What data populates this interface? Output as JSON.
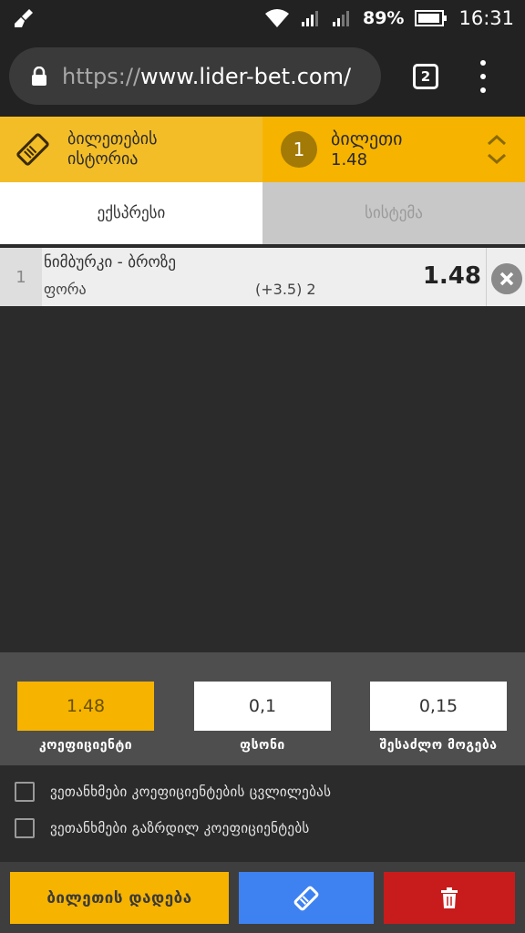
{
  "status_bar": {
    "battery": "89%",
    "time": "16:31",
    "icons": [
      "clean-broom-icon",
      "wifi-icon",
      "signal-icon",
      "signal-icon",
      "battery-icon"
    ]
  },
  "browser": {
    "url_scheme": "https://",
    "url_host": "www.lider-bet.com/",
    "tab_count": "2"
  },
  "header": {
    "history_label": "ბილეთების ისტორია",
    "ticket_count": "1",
    "ticket_title": "ბილეთი",
    "ticket_odds": "1.48"
  },
  "tabs": [
    {
      "label": "ექსპრესი",
      "active": true
    },
    {
      "label": "სისტემა",
      "active": false
    }
  ],
  "bet": {
    "index": "1",
    "match": "ნიმბურკი - ბროზე",
    "market": "ფორა",
    "line": "(+3.5) 2",
    "odds": "1.48"
  },
  "stake": {
    "odds_value": "1.48",
    "odds_label": "კოეფიციენტი",
    "stake_value": "0,1",
    "stake_label": "ფსონი",
    "win_value": "0,15",
    "win_label": "შესაძლო მოგება"
  },
  "options": [
    {
      "label": "ვეთანხმები კოეფიციენტების ცვლილებას",
      "checked": false
    },
    {
      "label": "ვეთანხმები გაზრდილ კოეფიციენტებს",
      "checked": false
    }
  ],
  "actions": {
    "place_label": "ბილეთის დადება"
  },
  "colors": {
    "accent_yellow": "#f6b300",
    "blue": "#3e82f2",
    "red": "#c81c1c",
    "dark_bg": "#2b2b2b"
  }
}
